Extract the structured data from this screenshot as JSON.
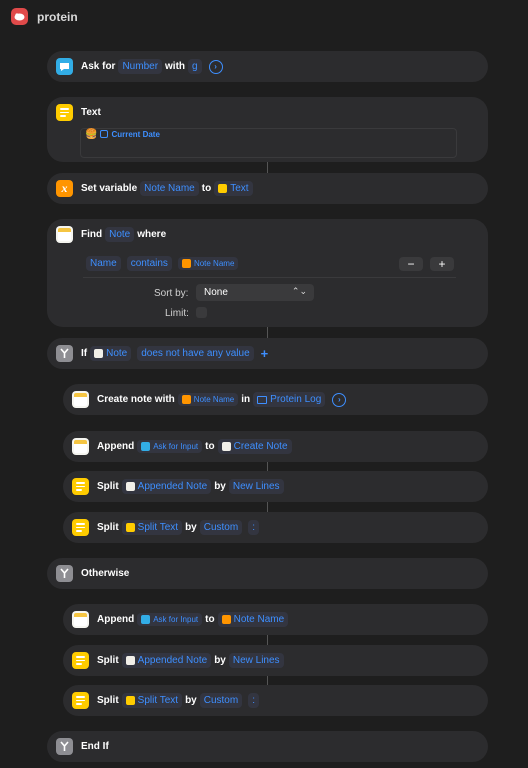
{
  "app": {
    "title": "protein"
  },
  "actions": {
    "ask": {
      "verb": "Ask for",
      "type": "Number",
      "with": "with",
      "prompt": "g"
    },
    "text": {
      "title": "Text",
      "emoji": "🍔",
      "var": "Current Date"
    },
    "set_var": {
      "verb": "Set variable",
      "name": "Note Name",
      "to": "to",
      "value": "Text"
    },
    "find": {
      "verb": "Find",
      "entity": "Note",
      "where": "where",
      "filter": {
        "field": "Name",
        "op": "contains",
        "value": "Note Name"
      },
      "minus": "−",
      "plus": "+",
      "sort_label": "Sort by:",
      "sort_value": "None",
      "limit_label": "Limit:"
    },
    "if": {
      "verb": "If",
      "var": "Note",
      "cond": "does not have any value",
      "add": "+"
    },
    "create_note": {
      "verb": "Create note with",
      "var": "Note Name",
      "in": "in",
      "folder": "Protein Log"
    },
    "append1": {
      "verb": "Append",
      "var": "Ask for Input",
      "to": "to",
      "target": "Create Note"
    },
    "split1": {
      "verb": "Split",
      "var": "Appended Note",
      "by": "by",
      "sep": "New Lines"
    },
    "split2": {
      "verb": "Split",
      "var": "Split Text",
      "by": "by",
      "sep": "Custom",
      "custom": ":"
    },
    "otherwise": {
      "label": "Otherwise"
    },
    "append2": {
      "verb": "Append",
      "var": "Ask for Input",
      "to": "to",
      "target": "Note Name"
    },
    "split3": {
      "verb": "Split",
      "var": "Appended Note",
      "by": "by",
      "sep": "New Lines"
    },
    "split4": {
      "verb": "Split",
      "var": "Split Text",
      "by": "by",
      "sep": "Custom",
      "custom": ":"
    },
    "endif": {
      "label": "End If"
    }
  }
}
